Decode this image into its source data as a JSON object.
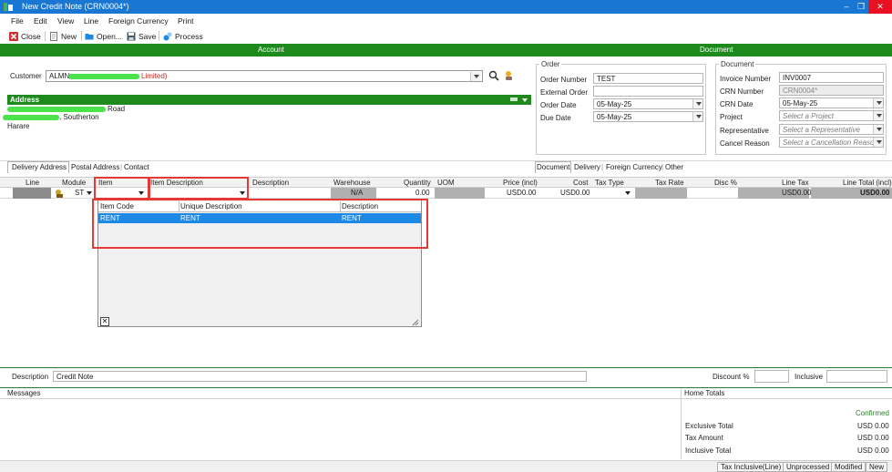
{
  "window": {
    "title": "New Credit Note (CRN0004*)",
    "minimize": "–",
    "restore": "❐",
    "close": "✕"
  },
  "menu": [
    "File",
    "Edit",
    "View",
    "Line",
    "Foreign Currency",
    "Print"
  ],
  "toolbar": {
    "close": "Close",
    "new": "New",
    "open": "Open...",
    "save": "Save",
    "process": "Process"
  },
  "headers": {
    "account": "Account",
    "document": "Document"
  },
  "customer": {
    "label": "Customer",
    "code": "ALMN",
    "name": "Limited)"
  },
  "address": {
    "title": "Address",
    "line1": "Road",
    "line2": ", Southerton",
    "line3": "Harare"
  },
  "order": {
    "title": "Order",
    "order_number_label": "Order Number",
    "order_number": "TEST",
    "external_order_label": "External Order",
    "external_order": "",
    "order_date_label": "Order Date",
    "order_date": "05-May-25",
    "due_date_label": "Due Date",
    "due_date": "05-May-25"
  },
  "document": {
    "title": "Document",
    "invoice_number_label": "Invoice Number",
    "invoice_number": "INV0007",
    "crn_number_label": "CRN Number",
    "crn_number": "CRN0004*",
    "crn_date_label": "CRN Date",
    "crn_date": "05-May-25",
    "project_label": "Project",
    "project_placeholder": "Select a Project",
    "representative_label": "Representative",
    "representative_placeholder": "Select a Representative",
    "cancel_reason_label": "Cancel Reason",
    "cancel_reason_placeholder": "Select a Cancellation Reason"
  },
  "address_tabs": [
    "Delivery Address",
    "Postal Address",
    "Contact"
  ],
  "document_tabs": [
    "Document",
    "Delivery",
    "Foreign Currency",
    "Other"
  ],
  "grid": {
    "columns": [
      "Line",
      "Module",
      "Item",
      "Item Description",
      "Description",
      "Warehouse",
      "Quantity",
      "UOM",
      "Price (incl)",
      "Cost",
      "Tax Type",
      "Tax Rate",
      "Disc %",
      "Line Tax",
      "Line Total (incl)"
    ],
    "row": {
      "module": "ST",
      "warehouse": "N/A",
      "quantity": "0.00",
      "price": "USD0.00",
      "cost": "USD0.00",
      "line_tax": "USD0.00",
      "line_total": "USD0.00"
    }
  },
  "item_popup": {
    "columns": [
      "Item Code",
      "Unique Description",
      "Description"
    ],
    "rows": [
      {
        "code": "RENT",
        "unique": "RENT",
        "description": "RENT"
      }
    ],
    "close_glyph": "✕"
  },
  "footer": {
    "description_label": "Description",
    "description_value": "Credit Note",
    "discount_label": "Discount %",
    "inclusive_label": "Inclusive",
    "messages_label": "Messages",
    "home_totals_label": "Home Totals",
    "confirmed": "Confirmed",
    "exclusive_total_label": "Exclusive Total",
    "exclusive_total": "USD 0.00",
    "tax_amount_label": "Tax Amount",
    "tax_amount": "USD 0.00",
    "inclusive_total_label": "Inclusive Total",
    "inclusive_total": "USD 0.00"
  },
  "status": [
    "Tax Inclusive(Line)",
    "Unprocessed",
    "Modified",
    "New"
  ],
  "colors": {
    "titlebar": "#1976d2",
    "green": "#1e8a1e",
    "highlight": "#1e88e5",
    "redbox": "#e53935"
  }
}
